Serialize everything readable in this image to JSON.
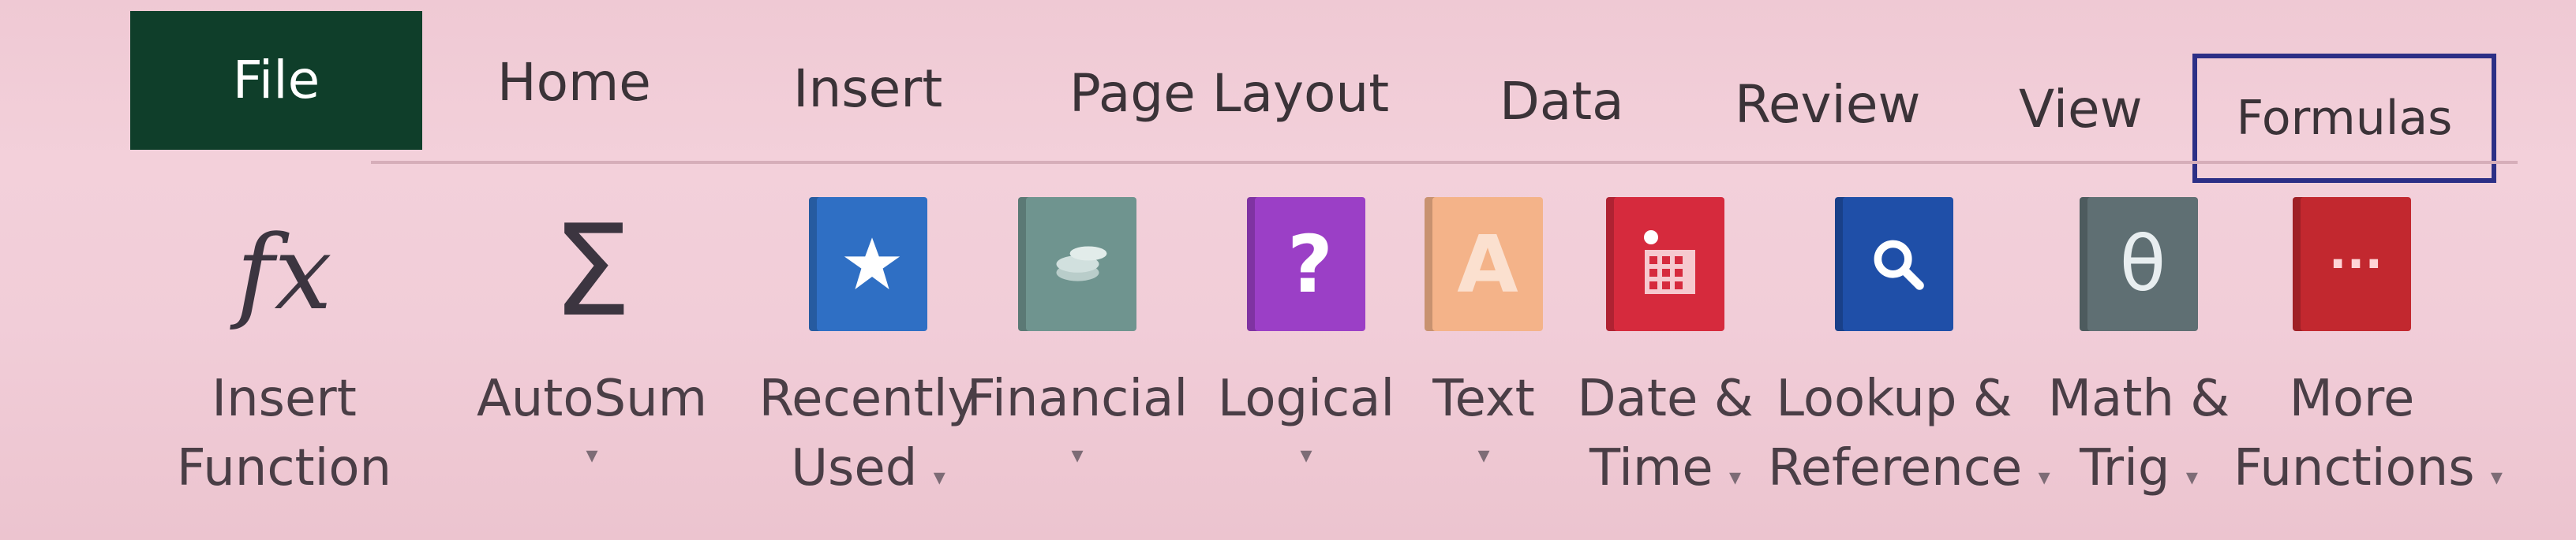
{
  "tabs": {
    "file": "File",
    "home": "Home",
    "insert": "Insert",
    "page_layout": "Page Layout",
    "data": "Data",
    "review": "Review",
    "view": "View",
    "formulas": "Formulas"
  },
  "ribbon": {
    "insert_function": {
      "line1": "Insert",
      "line2": "Function",
      "icon": "fx-icon"
    },
    "autosum": {
      "line1": "AutoSum",
      "icon": "sigma-icon"
    },
    "recently_used": {
      "line1": "Recently",
      "line2": "Used",
      "icon": "star-book-icon",
      "color": "#2f6fc4"
    },
    "financial": {
      "line1": "Financial",
      "icon": "coins-book-icon",
      "color": "#6f948f"
    },
    "logical": {
      "line1": "Logical",
      "icon": "question-book-icon",
      "color": "#9b3fc6"
    },
    "text": {
      "line1": "Text",
      "icon": "letter-a-book-icon",
      "color": "#f4b389"
    },
    "date_time": {
      "line1": "Date &",
      "line2": "Time",
      "icon": "calendar-book-icon",
      "color": "#d62a3d"
    },
    "lookup_reference": {
      "line1": "Lookup &",
      "line2": "Reference",
      "icon": "magnifier-book-icon",
      "color": "#1f4fa8"
    },
    "math_trig": {
      "line1": "Math &",
      "line2": "Trig",
      "icon": "theta-book-icon",
      "color": "#5f6f73"
    },
    "more_functions": {
      "line1": "More",
      "line2": "Functions",
      "icon": "ellipsis-book-icon",
      "color": "#c2282f"
    }
  },
  "symbols": {
    "fx": "fx",
    "sigma": "Σ",
    "question": "?",
    "letter_a": "A",
    "theta": "θ",
    "ellipsis": "···",
    "dropdown_arrow": "▾"
  }
}
